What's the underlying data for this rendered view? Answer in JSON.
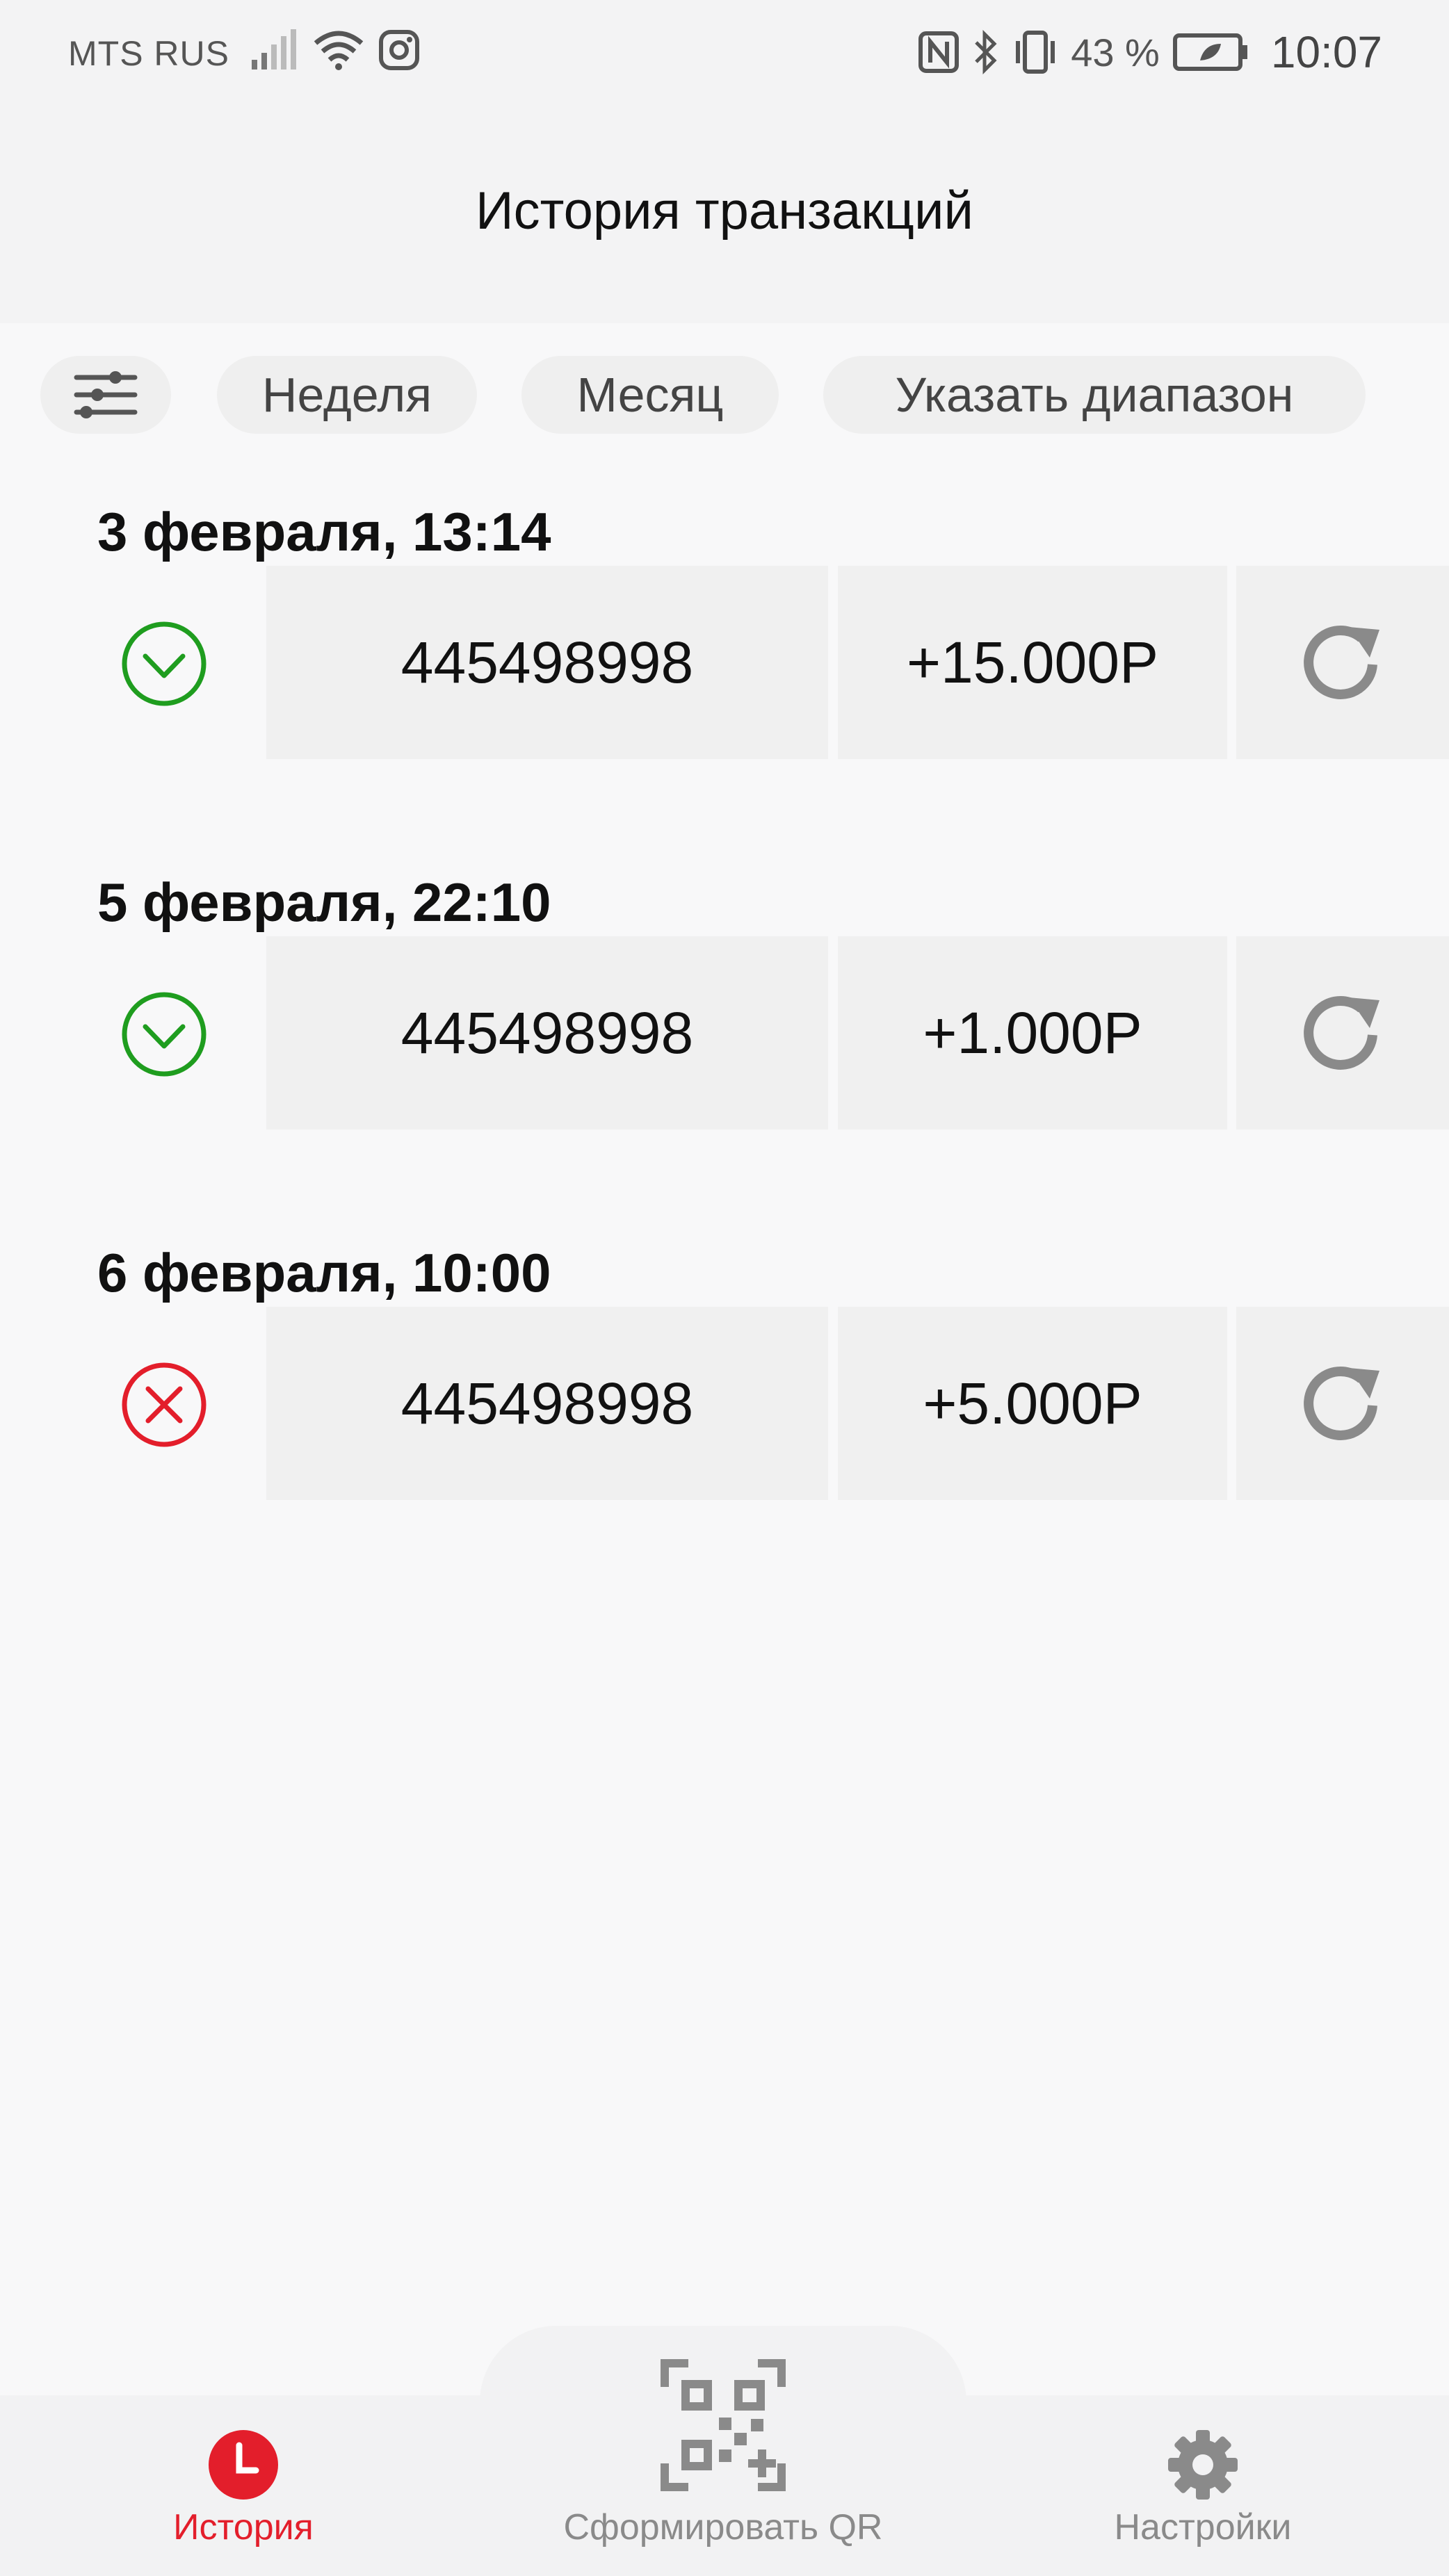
{
  "status_bar": {
    "carrier": "MTS RUS",
    "battery_percent": "43 %",
    "time": "10:07",
    "icons": [
      "signal-icon",
      "wifi-icon",
      "instagram-icon",
      "nfc-icon",
      "bluetooth-icon",
      "vibrate-icon",
      "battery-icon"
    ]
  },
  "header": {
    "title": "История транзакций"
  },
  "filters": {
    "settings_icon": "sliders-icon",
    "week": "Неделя",
    "month": "Месяц",
    "range": "Указать диапазон"
  },
  "transactions": [
    {
      "date": "3 февраля, 13:14",
      "status": "success",
      "account": "445498998",
      "amount": "+15.000Р"
    },
    {
      "date": "5 февраля, 22:10",
      "status": "success",
      "account": "445498998",
      "amount": "+1.000Р"
    },
    {
      "date": "6 февраля, 10:00",
      "status": "failed",
      "account": "445498998",
      "amount": "+5.000Р"
    }
  ],
  "bottom_nav": {
    "history": "История",
    "qr": "Сформировать QR",
    "settings": "Настройки"
  },
  "colors": {
    "accent": "#e31e2b",
    "success": "#1f9d1f",
    "failed": "#e31e2b",
    "icon_gray": "#8a8a8a"
  }
}
